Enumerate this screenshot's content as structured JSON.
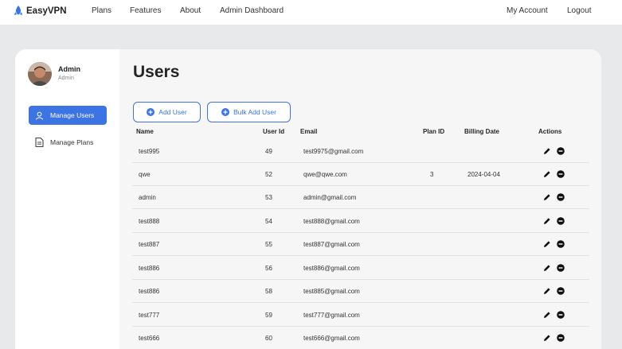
{
  "brand": {
    "name": "EasyVPN"
  },
  "nav": {
    "plans": "Plans",
    "features": "Features",
    "about": "About",
    "admin_dashboard": "Admin Dashboard",
    "my_account": "My Account",
    "logout": "Logout"
  },
  "profile": {
    "name": "Admin",
    "role": "Admin"
  },
  "sidebar": {
    "items": [
      {
        "label": "Manage Users"
      },
      {
        "label": "Manage Plans"
      }
    ]
  },
  "page": {
    "title": "Users"
  },
  "actions": {
    "add_user": "Add User",
    "bulk_add_user": "Bulk Add User"
  },
  "table": {
    "columns": [
      "Name",
      "User Id",
      "Email",
      "Plan ID",
      "Billing Date",
      "Actions"
    ],
    "rows": [
      {
        "name": "test995",
        "id": "49",
        "email": "test9975@gmail.com",
        "plan": "",
        "billing": ""
      },
      {
        "name": "qwe",
        "id": "52",
        "email": "qwe@qwe.com",
        "plan": "3",
        "billing": "2024-04-04"
      },
      {
        "name": "admin",
        "id": "53",
        "email": "admin@gmail.com",
        "plan": "",
        "billing": ""
      },
      {
        "name": "test888",
        "id": "54",
        "email": "test888@gmail.com",
        "plan": "",
        "billing": ""
      },
      {
        "name": "test887",
        "id": "55",
        "email": "test887@gmail.com",
        "plan": "",
        "billing": ""
      },
      {
        "name": "test886",
        "id": "56",
        "email": "test886@gmail.com",
        "plan": "",
        "billing": ""
      },
      {
        "name": "test886",
        "id": "58",
        "email": "test885@gmail.com",
        "plan": "",
        "billing": ""
      },
      {
        "name": "test777",
        "id": "59",
        "email": "test777@gmail.com",
        "plan": "",
        "billing": ""
      },
      {
        "name": "test666",
        "id": "60",
        "email": "test666@gmail.com",
        "plan": "",
        "billing": ""
      }
    ]
  },
  "colors": {
    "accent": "#3c74e4",
    "background": "#e8e9eb",
    "panel": "#f6f6f7"
  }
}
